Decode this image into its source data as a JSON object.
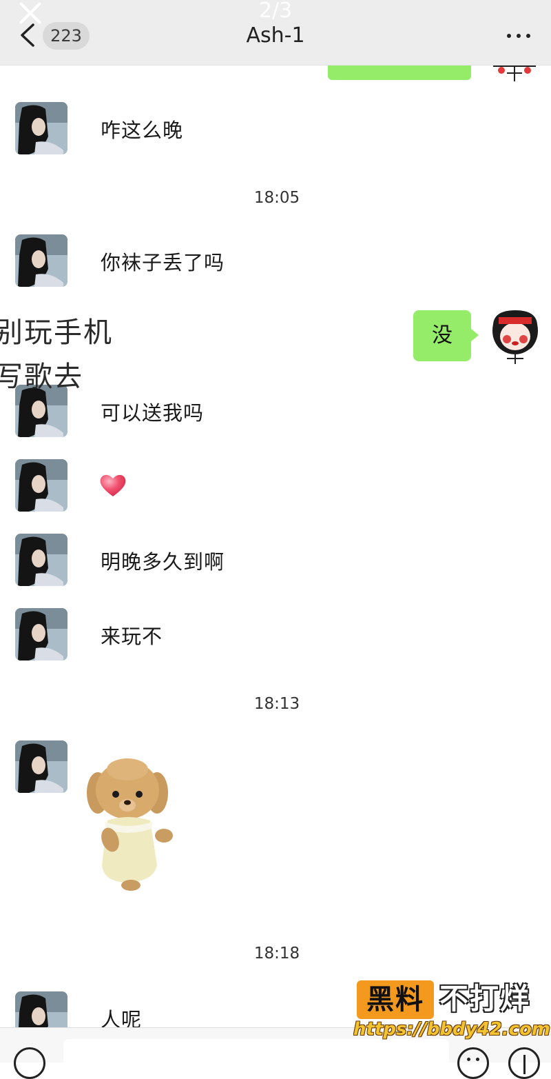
{
  "viewer": {
    "page_counter": "2/3"
  },
  "header": {
    "unread_count": "223",
    "title": "Ash-1"
  },
  "messages": [
    {
      "text": "咋这么晚"
    },
    {
      "text": "你袜子丢了吗"
    },
    {
      "text": "可以送我吗"
    },
    {
      "text": "明晚多久到啊"
    },
    {
      "text": "来玩不"
    },
    {
      "text": "人呢"
    }
  ],
  "my_message": {
    "text": "没"
  },
  "timestamps": [
    "18:05",
    "18:13",
    "18:18"
  ],
  "overlay_lines": [
    "别玩手机",
    "写歌去"
  ],
  "watermark": {
    "badge": "黑料",
    "text": "不打烊",
    "url": "https://bbdy42.com"
  },
  "colors": {
    "bubble_green": "#95ec69",
    "header_bg": "#ededed",
    "heart": "#f0506e"
  },
  "icons": [
    "close-icon",
    "chevron-left-icon",
    "more-icon",
    "voice-icon",
    "emoji-icon",
    "plus-icon"
  ]
}
